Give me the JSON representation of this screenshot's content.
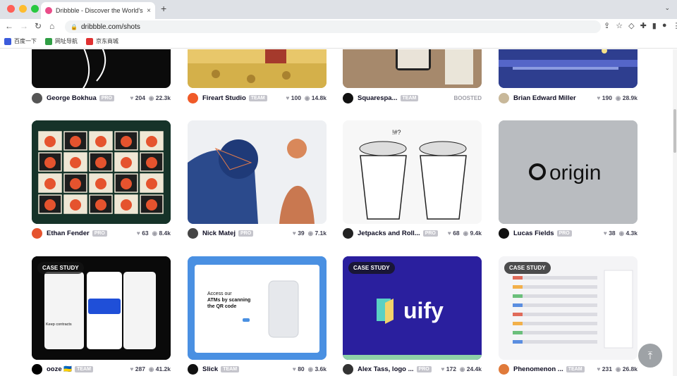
{
  "browser": {
    "tab_title": "Dribbble - Discover the World's",
    "tab_close": "×",
    "new_tab": "+",
    "url": "dribbble.com/shots"
  },
  "bookmarks": [
    {
      "label": "百度一下",
      "color": "#3b5bdb"
    },
    {
      "label": "网址导航",
      "color": "#2f9e44"
    },
    {
      "label": "京东商城",
      "color": "#e03131"
    }
  ],
  "shots": [
    {
      "author": "George Bokhua",
      "badge": "PRO",
      "likes": "204",
      "views": "22.3k",
      "bg": "#0b0b0b",
      "avatar": "#555"
    },
    {
      "author": "Fireart Studio",
      "badge": "TEAM",
      "likes": "100",
      "views": "14.8k",
      "bg": "#c9a656",
      "avatar": "#f05a28"
    },
    {
      "author": "Squarespa...",
      "badge": "TEAM",
      "boosted": "BOOSTED",
      "bg": "#b7a086",
      "avatar": "#111"
    },
    {
      "author": "Brian Edward Miller",
      "badge": "",
      "likes": "190",
      "views": "28.9k",
      "bg": "#3a4fa3",
      "avatar": "#c8b89a"
    },
    {
      "author": "Ethan Fender",
      "badge": "PRO",
      "likes": "63",
      "views": "8.4k",
      "bg": "#163329",
      "avatar": "#e5532e"
    },
    {
      "author": "Nick Matej",
      "badge": "PRO",
      "likes": "39",
      "views": "7.1k",
      "bg": "#eef0f3",
      "avatar": "#444"
    },
    {
      "author": "Jetpacks and Roll...",
      "badge": "PRO",
      "likes": "68",
      "views": "9.4k",
      "bg": "#f7f7f7",
      "avatar": "#222"
    },
    {
      "author": "Lucas Fields",
      "badge": "PRO",
      "likes": "38",
      "views": "4.3k",
      "bg": "#b9bcc0",
      "avatar": "#111"
    },
    {
      "author": "ooze 🇺🇦",
      "badge": "TEAM",
      "likes": "287",
      "views": "41.2k",
      "bg": "#0a0a0a",
      "avatar": "#000",
      "case": "CASE STUDY"
    },
    {
      "author": "Slick",
      "badge": "TEAM",
      "likes": "80",
      "views": "3.6k",
      "bg": "#4a90e2",
      "avatar": "#111"
    },
    {
      "author": "Alex Tass, logo ...",
      "badge": "PRO",
      "likes": "172",
      "views": "24.4k",
      "bg": "#2a1f9e",
      "avatar": "#333",
      "case": "CASE STUDY"
    },
    {
      "author": "Phenomenon ...",
      "badge": "TEAM",
      "likes": "231",
      "views": "26.8k",
      "bg": "#f4f4f6",
      "avatar": "#e07a3a",
      "case": "CASE STUDY"
    }
  ],
  "origin_text": "origin",
  "uify_text": "uify",
  "slick_heading": "Access our ATMs by scanning the QR code",
  "ooze_text": "Keep contracts under the control",
  "icons": {
    "heart": "♥",
    "eye": "◉",
    "up": "⤒"
  }
}
